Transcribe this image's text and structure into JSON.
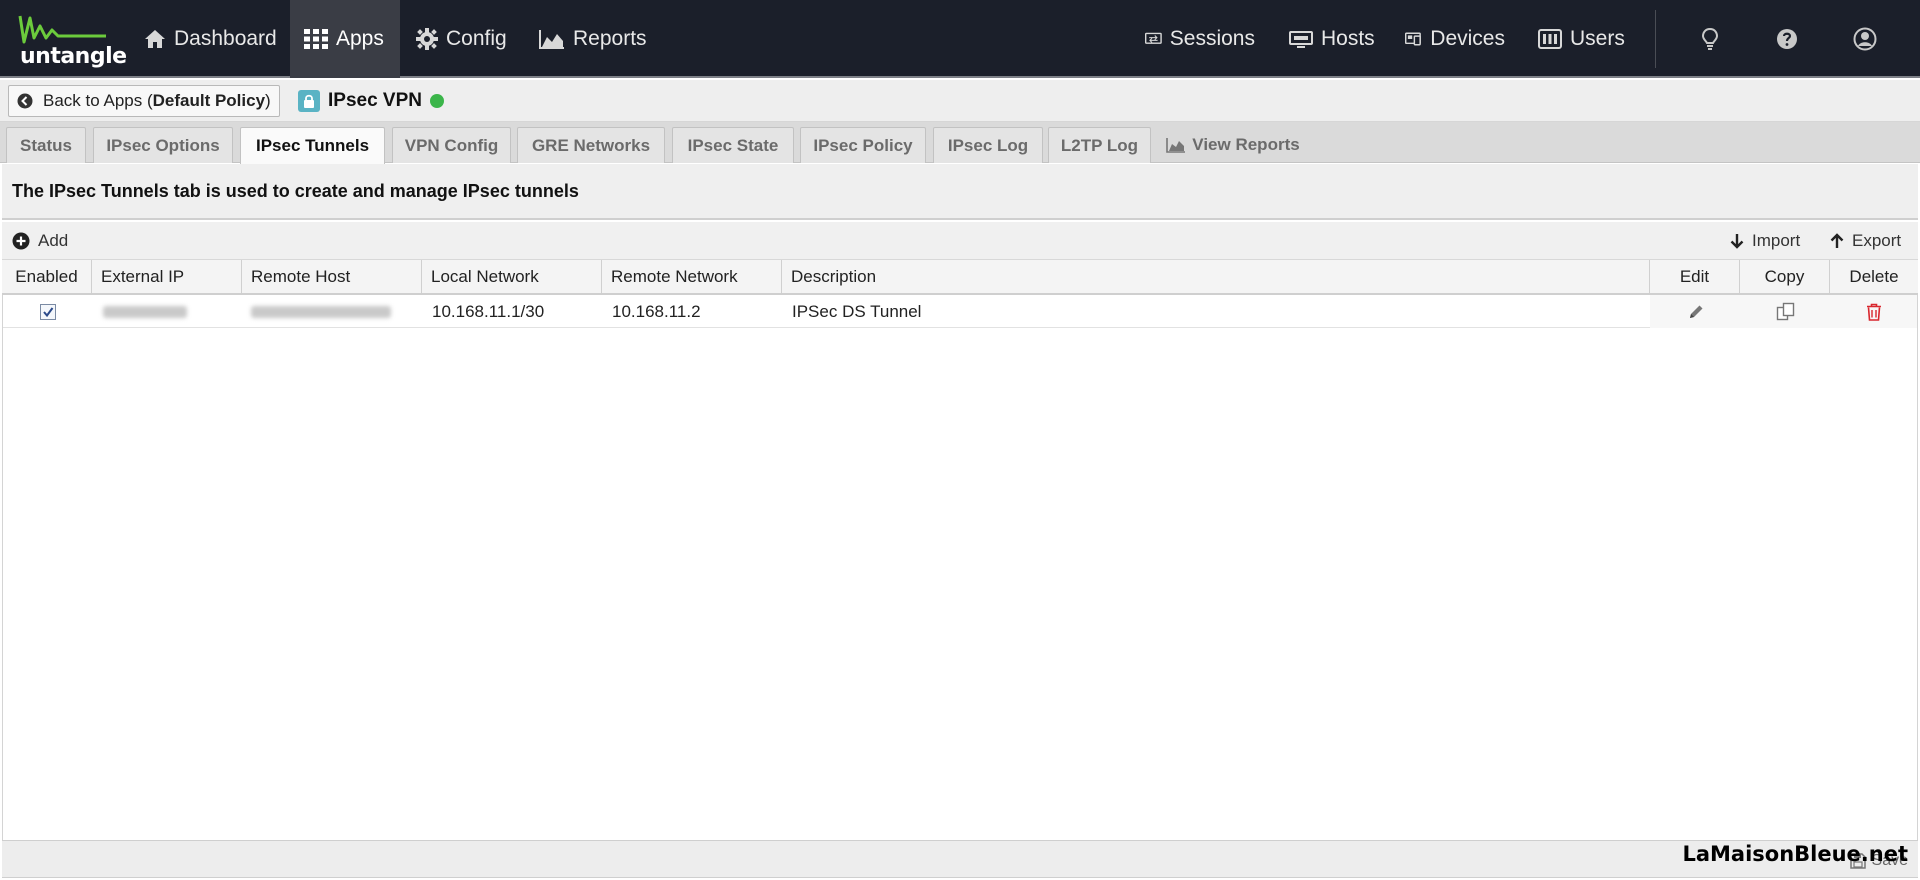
{
  "topbar": {
    "logo_text": "untangle",
    "nav": [
      {
        "label": "Dashboard",
        "icon": "home-icon"
      },
      {
        "label": "Apps",
        "icon": "grid-icon"
      },
      {
        "label": "Config",
        "icon": "gear-icon"
      },
      {
        "label": "Reports",
        "icon": "area-chart-icon"
      }
    ],
    "right_nav": [
      {
        "label": "Sessions",
        "icon": "sessions-icon"
      },
      {
        "label": "Hosts",
        "icon": "hosts-icon"
      },
      {
        "label": "Devices",
        "icon": "devices-icon"
      },
      {
        "label": "Users",
        "icon": "users-icon"
      }
    ],
    "icons": [
      "lightbulb-icon",
      "help-icon",
      "user-account-icon"
    ]
  },
  "appbar": {
    "back_prefix": "Back to Apps (",
    "back_policy": "Default Policy",
    "back_suffix": ")",
    "app_name": "IPsec VPN",
    "status_color": "#3bb54a"
  },
  "tabs": [
    {
      "label": "Status"
    },
    {
      "label": "IPsec Options"
    },
    {
      "label": "IPsec Tunnels",
      "active": true
    },
    {
      "label": "VPN Config"
    },
    {
      "label": "GRE Networks"
    },
    {
      "label": "IPsec State"
    },
    {
      "label": "IPsec Policy"
    },
    {
      "label": "IPsec Log"
    },
    {
      "label": "L2TP Log"
    },
    {
      "label": "View Reports"
    }
  ],
  "description": "The IPsec Tunnels tab is used to create and manage IPsec tunnels",
  "toolbar": {
    "add_label": "Add",
    "import_label": "Import",
    "export_label": "Export"
  },
  "grid": {
    "columns": [
      "Enabled",
      "External IP",
      "Remote Host",
      "Local Network",
      "Remote Network",
      "Description",
      "Edit",
      "Copy",
      "Delete"
    ],
    "rows": [
      {
        "enabled": true,
        "external_ip": "",
        "remote_host": "",
        "local_network": "10.168.11.1/30",
        "remote_network": "10.168.11.2",
        "description": "IPSec DS Tunnel"
      }
    ]
  },
  "footer": {
    "save_label": "Save",
    "watermark": "LaMaisonBleue.net"
  },
  "colors": {
    "topbar_bg": "#1b1f2a",
    "logo_green": "#6ccb3c",
    "delete_red": "#d9272e"
  }
}
